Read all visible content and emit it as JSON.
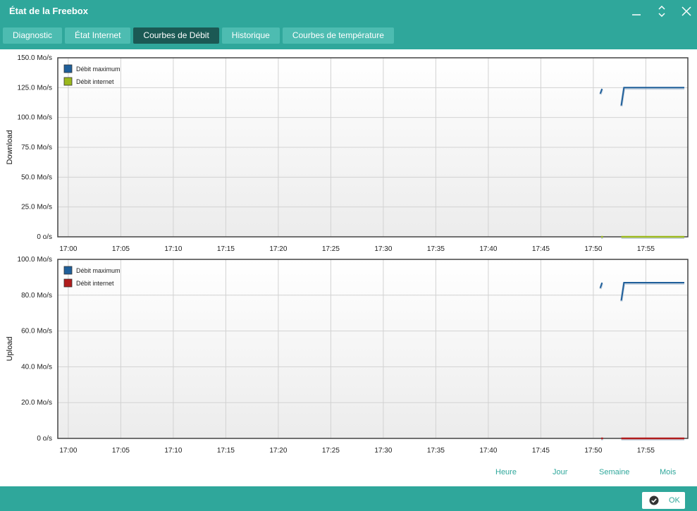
{
  "window": {
    "title": "État de la Freebox",
    "controls": [
      "minimize-icon",
      "expand-icon",
      "close-icon"
    ]
  },
  "tabs": [
    {
      "label": "Diagnostic",
      "active": false
    },
    {
      "label": "État Internet",
      "active": false
    },
    {
      "label": "Courbes de Débit",
      "active": true
    },
    {
      "label": "Historique",
      "active": false
    },
    {
      "label": "Courbes de température",
      "active": false
    }
  ],
  "time_ranges": [
    {
      "label": "Heure"
    },
    {
      "label": "Jour"
    },
    {
      "label": "Semaine"
    },
    {
      "label": "Mois"
    }
  ],
  "footer": {
    "ok_label": "OK"
  },
  "colors": {
    "accent": "#2fa79b",
    "active_tab": "#1b5954",
    "max_series": "#1f5f9a",
    "download_series": "#9bb81c",
    "upload_series": "#b01c1c"
  },
  "chart_data": [
    {
      "type": "line",
      "ylabel": "Download",
      "xlabel": "",
      "title": "",
      "x_ticks": [
        "17:00",
        "17:05",
        "17:10",
        "17:15",
        "17:20",
        "17:25",
        "17:30",
        "17:35",
        "17:40",
        "17:45",
        "17:50",
        "17:55"
      ],
      "x_range": [
        "16:59",
        "17:59"
      ],
      "y_ticks": [
        "0 o/s",
        "25.0 Mo/s",
        "50.0 Mo/s",
        "75.0 Mo/s",
        "100.0 Mo/s",
        "125.0 Mo/s",
        "150.0 Mo/s"
      ],
      "ylim": [
        0,
        150
      ],
      "unit": "Mo/s",
      "grid": true,
      "legend": "top-left",
      "series": [
        {
          "name": "Débit maximum",
          "color": "#1f5f9a",
          "segments": [
            [
              [
                "17:50:40",
                120
              ],
              [
                "17:50:50",
                124
              ]
            ],
            [
              [
                "17:52:40",
                110
              ],
              [
                "17:52:55",
                125
              ],
              [
                "17:58:40",
                125
              ]
            ]
          ]
        },
        {
          "name": "Débit internet",
          "color": "#9bb81c",
          "segments": [
            [
              [
                "17:50:45",
                0
              ],
              [
                "17:50:55",
                0
              ]
            ],
            [
              [
                "17:52:40",
                0
              ],
              [
                "17:58:40",
                0
              ]
            ]
          ]
        }
      ]
    },
    {
      "type": "line",
      "ylabel": "Upload",
      "xlabel": "",
      "title": "",
      "x_ticks": [
        "17:00",
        "17:05",
        "17:10",
        "17:15",
        "17:20",
        "17:25",
        "17:30",
        "17:35",
        "17:40",
        "17:45",
        "17:50",
        "17:55"
      ],
      "x_range": [
        "16:59",
        "17:59"
      ],
      "y_ticks": [
        "0 o/s",
        "20.0 Mo/s",
        "40.0 Mo/s",
        "60.0 Mo/s",
        "80.0 Mo/s",
        "100.0 Mo/s"
      ],
      "ylim": [
        0,
        100
      ],
      "unit": "Mo/s",
      "grid": true,
      "legend": "top-left",
      "series": [
        {
          "name": "Débit maximum",
          "color": "#1f5f9a",
          "segments": [
            [
              [
                "17:50:40",
                84
              ],
              [
                "17:50:50",
                87
              ]
            ],
            [
              [
                "17:52:40",
                77
              ],
              [
                "17:52:55",
                87
              ],
              [
                "17:58:40",
                87
              ]
            ]
          ]
        },
        {
          "name": "Débit internet",
          "color": "#b01c1c",
          "segments": [
            [
              [
                "17:50:45",
                0
              ],
              [
                "17:50:55",
                0
              ]
            ],
            [
              [
                "17:52:40",
                0
              ],
              [
                "17:58:40",
                0
              ]
            ]
          ]
        }
      ]
    }
  ]
}
